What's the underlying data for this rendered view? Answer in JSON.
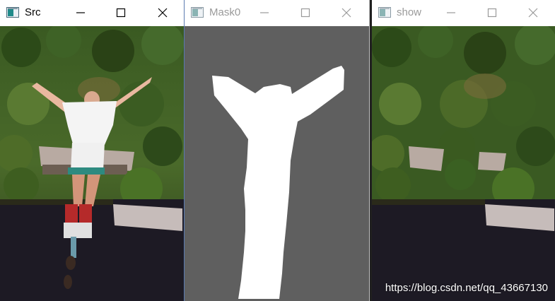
{
  "windows": [
    {
      "title": "Src",
      "state": "active"
    },
    {
      "title": "Mask0",
      "state": "inactive"
    },
    {
      "title": "show",
      "state": "inactive"
    }
  ],
  "icons": {
    "app": "window-app-icon",
    "minimize": "minimize-icon",
    "maximize": "maximize-icon",
    "close": "close-icon"
  },
  "colors": {
    "mask_background": "#5f5f5f",
    "mask_foreground": "#ffffff",
    "water": "#1d1a24",
    "foliage": "#2f4a1c"
  },
  "watermark": "https://blog.csdn.net/qq_43667130"
}
